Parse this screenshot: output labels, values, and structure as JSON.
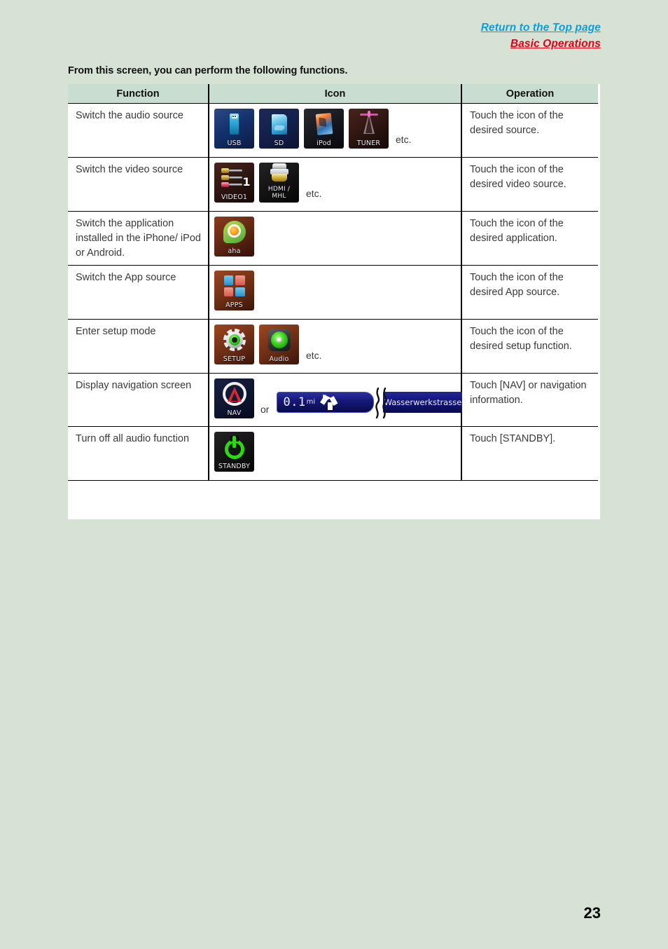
{
  "top_links": [
    {
      "label": "Return to the Top page",
      "color": "#0d9ddb"
    },
    {
      "label": "Basic Operations",
      "color": "#e00018"
    }
  ],
  "intro": "From this screen, you can perform the following functions.",
  "table": {
    "headers": {
      "function": "Function",
      "icon": "Icon",
      "operation": "Operation"
    },
    "rows": [
      {
        "function": "Switch the audio source",
        "operation": "Touch the icon of the desired source.",
        "suffix": "etc.",
        "icons": [
          {
            "label": "USB",
            "name": "usb-icon"
          },
          {
            "label": "SD",
            "name": "sd-icon"
          },
          {
            "label": "iPod",
            "name": "ipod-icon"
          },
          {
            "label": "TUNER",
            "name": "tuner-icon"
          }
        ]
      },
      {
        "function": "Switch the video source",
        "operation": "Touch the icon of the desired video source.",
        "suffix": "etc.",
        "icons": [
          {
            "label": "VIDEO1",
            "name": "video1-icon"
          },
          {
            "label": "HDMI / MHL",
            "label_line1": "HDMI /",
            "label_line2": "MHL",
            "name": "hdmi-mhl-icon"
          }
        ]
      },
      {
        "function": "Switch the application installed in the iPhone/ iPod or Android.",
        "operation": "Touch the icon of the desired application.",
        "suffix": "",
        "icons": [
          {
            "label": "aha",
            "name": "aha-icon"
          }
        ]
      },
      {
        "function": "Switch the App source",
        "operation": "Touch the icon of the desired App source.",
        "suffix": "",
        "icons": [
          {
            "label": "APPS",
            "name": "apps-icon"
          }
        ]
      },
      {
        "function": "Enter setup mode",
        "operation": "Touch the icon of the desired setup function.",
        "suffix": "etc.",
        "icons": [
          {
            "label": "SETUP",
            "name": "setup-icon"
          },
          {
            "label": "Audio",
            "name": "audio-icon"
          }
        ]
      },
      {
        "function": "Display navigation screen",
        "operation": "Touch [NAV] or navigation information.",
        "suffix": "",
        "or_label": "or",
        "icons": [
          {
            "label": "NAV",
            "name": "nav-icon"
          }
        ],
        "nav_info": {
          "distance": "0.1",
          "unit": "mi",
          "street": "Wasserwerkstrasse"
        }
      },
      {
        "function": "Turn off all audio function",
        "operation": "Touch [STANDBY].",
        "suffix": "",
        "icons": [
          {
            "label": "STANDBY",
            "name": "standby-icon"
          }
        ]
      }
    ]
  },
  "page_number": "23"
}
